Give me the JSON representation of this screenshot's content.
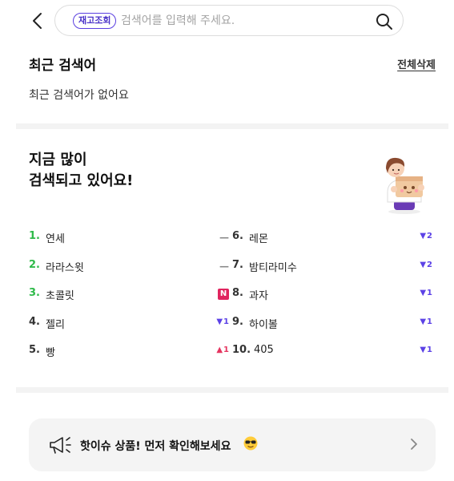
{
  "search": {
    "chip": "재고조회",
    "placeholder": "검색어를 입력해 주세요."
  },
  "recent": {
    "title": "최근 검색어",
    "clear_all": "전체삭제",
    "empty": "최근 검색어가 없어요"
  },
  "popular": {
    "title_line1": "지금 많이",
    "title_line2": "검색되고 있어요!",
    "left": [
      {
        "rank": "1.",
        "term": "연세",
        "change": "—",
        "type": "same"
      },
      {
        "rank": "2.",
        "term": "라라스윗",
        "change": "—",
        "type": "same"
      },
      {
        "rank": "3.",
        "term": "초콜릿",
        "change": "N",
        "type": "new"
      },
      {
        "rank": "4.",
        "term": "젤리",
        "change": "1",
        "type": "down"
      },
      {
        "rank": "5.",
        "term": "빵",
        "change": "1",
        "type": "up"
      }
    ],
    "right": [
      {
        "rank": "6.",
        "term": "레몬",
        "change": "2",
        "type": "down"
      },
      {
        "rank": "7.",
        "term": "밤티라미수",
        "change": "2",
        "type": "down"
      },
      {
        "rank": "8.",
        "term": "과자",
        "change": "1",
        "type": "down"
      },
      {
        "rank": "9.",
        "term": "하이볼",
        "change": "1",
        "type": "down"
      },
      {
        "rank": "10.",
        "term": "405",
        "change": "1",
        "type": "down"
      }
    ]
  },
  "banner": {
    "text": "핫이슈 상품! 먼저 확인해보세요"
  },
  "colors": {
    "accent": "#5a3fe0",
    "top_rank": "#2fba4a",
    "down": "#5c42e6",
    "up": "#e5345f",
    "new": "#e0245e"
  }
}
